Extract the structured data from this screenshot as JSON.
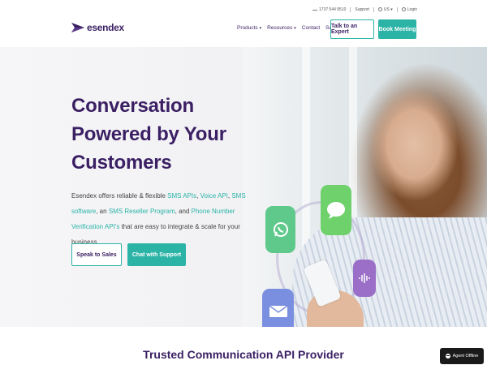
{
  "utility": {
    "phone": "1737 544 9510",
    "support": "Support",
    "region": "US",
    "login": "Login"
  },
  "header": {
    "logo_text": "esendex",
    "nav": [
      {
        "label": "Products",
        "has_dropdown": true
      },
      {
        "label": "Resources",
        "has_dropdown": true
      },
      {
        "label": "Contact",
        "has_dropdown": false
      },
      {
        "label": "Sales",
        "has_dropdown": false
      }
    ],
    "talk_button": "Talk to an Expert",
    "book_button": "Book Meeting"
  },
  "hero": {
    "headline_lines": [
      "Conversation",
      "Powered by Your",
      "Customers"
    ],
    "body_parts": {
      "p1": "Esendex offers reliable & flexible ",
      "l1": "SMS APIs",
      "p2": ", ",
      "l2": "Voice API",
      "p3": ", ",
      "l3": "SMS software",
      "p4": ", an ",
      "l4": "SMS Reseller Program",
      "p5": ", and ",
      "l5": "Phone Number Verification API's",
      "p6": " that are easy to integrate & scale for your business."
    },
    "cta_primary": "Speak to Sales",
    "cta_secondary": "Chat with Support"
  },
  "section": {
    "title": "Trusted Communication API Provider"
  },
  "chat_widget": {
    "label": "Agent Offline"
  },
  "colors": {
    "brand_purple": "#3a1f63",
    "accent_teal": "#2bb3a6"
  },
  "icons": [
    "whatsapp-icon",
    "chat-bubble-icon",
    "voice-wave-icon",
    "email-icon",
    "globe-icon",
    "user-icon",
    "chat-widget-icon"
  ]
}
